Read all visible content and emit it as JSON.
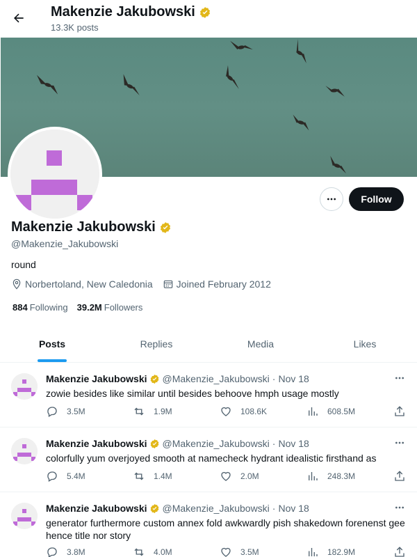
{
  "header": {
    "title": "Makenzie Jakubowski",
    "subtitle": "13.3K posts"
  },
  "colors": {
    "verified_badge": "#e2b719",
    "accent": "#1d9bf0",
    "avatar_pattern": "#bf6bd8"
  },
  "profile": {
    "name": "Makenzie Jakubowski",
    "handle": "@Makenzie_Jakubowski",
    "bio": "round",
    "location": "Norbertoland, New Caledonia",
    "joined": "Joined February 2012",
    "following_count": "884",
    "following_label": "Following",
    "followers_count": "39.2M",
    "followers_label": "Followers",
    "follow_label": "Follow"
  },
  "tabs": [
    {
      "label": "Posts",
      "active": true
    },
    {
      "label": "Replies",
      "active": false
    },
    {
      "label": "Media",
      "active": false
    },
    {
      "label": "Likes",
      "active": false
    }
  ],
  "posts": [
    {
      "author": "Makenzie Jakubowski",
      "handle": "@Makenzie_Jakubowski",
      "date": "Nov 18",
      "text": "zowie besides like similar until besides behoove hmph usage mostly",
      "replies": "3.5M",
      "reposts": "1.9M",
      "likes": "108.6K",
      "views": "608.5M"
    },
    {
      "author": "Makenzie Jakubowski",
      "handle": "@Makenzie_Jakubowski",
      "date": "Nov 18",
      "text": "colorfully yum overjoyed smooth at namecheck hydrant idealistic firsthand as",
      "replies": "5.4M",
      "reposts": "1.4M",
      "likes": "2.0M",
      "views": "248.3M"
    },
    {
      "author": "Makenzie Jakubowski",
      "handle": "@Makenzie_Jakubowski",
      "date": "Nov 18",
      "text": "generator furthermore custom annex fold awkwardly pish shakedown forenenst gee hence title nor story",
      "replies": "3.8M",
      "reposts": "4.0M",
      "likes": "3.5M",
      "views": "182.9M"
    }
  ],
  "post_dot": "·"
}
